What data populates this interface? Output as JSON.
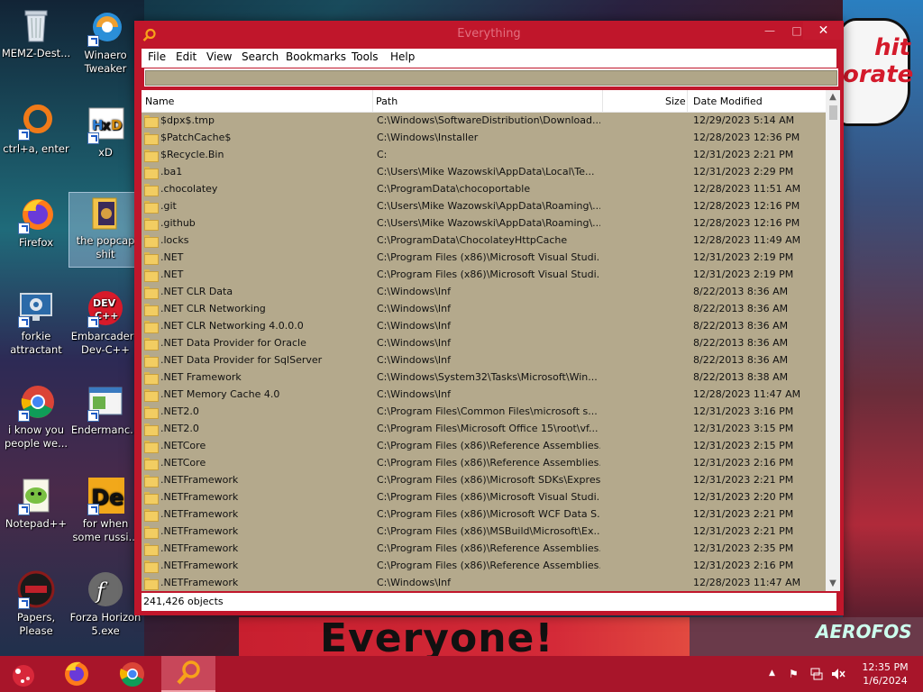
{
  "wallpaper": {
    "bubble_text": "hit\norate",
    "banner_text": "Everyone!",
    "corner_text": "AEROFOS"
  },
  "desktop_icons": [
    {
      "label": "MEMZ-Dest...",
      "icon": "recycle-bin-icon"
    },
    {
      "label": "Winaero Tweaker",
      "icon": "winaero-icon"
    },
    {
      "label": "ctrl+a, enter",
      "icon": "ring-icon"
    },
    {
      "label": "xD",
      "icon": "hxd-icon"
    },
    {
      "label": "Firefox",
      "icon": "firefox-icon"
    },
    {
      "label": "the popcap shit",
      "icon": "folder-icon"
    },
    {
      "label": "forkie attractant",
      "icon": "monitor-gear-icon"
    },
    {
      "label": "Embarcadero Dev-C++",
      "icon": "devcpp-icon"
    },
    {
      "label": "i know you people we...",
      "icon": "chrome-icon"
    },
    {
      "label": "Endermanc...",
      "icon": "window-icon"
    },
    {
      "label": "Notepad++",
      "icon": "notepadpp-icon"
    },
    {
      "label": "for when some russi...",
      "icon": "de-icon"
    },
    {
      "label": "Papers, Please",
      "icon": "papers-please-icon"
    },
    {
      "label": "Forza Horizon 5.exe",
      "icon": "flash-icon"
    }
  ],
  "window": {
    "title": "Everything",
    "menu": [
      "File",
      "Edit",
      "View",
      "Search",
      "Bookmarks",
      "Tools",
      "Help"
    ],
    "search": {
      "value": ""
    },
    "columns": {
      "name": "Name",
      "path": "Path",
      "size": "Size",
      "date": "Date Modified"
    },
    "rows": [
      {
        "name": "$dpx$.tmp",
        "path": "C:\\Windows\\SoftwareDistribution\\Download...",
        "date": "12/29/2023 5:14 AM"
      },
      {
        "name": "$PatchCache$",
        "path": "C:\\Windows\\Installer",
        "date": "12/28/2023 12:36 PM"
      },
      {
        "name": "$Recycle.Bin",
        "path": "C:",
        "date": "12/31/2023 2:21 PM"
      },
      {
        "name": ".ba1",
        "path": "C:\\Users\\Mike Wazowski\\AppData\\Local\\Te...",
        "date": "12/31/2023 2:29 PM"
      },
      {
        "name": ".chocolatey",
        "path": "C:\\ProgramData\\chocoportable",
        "date": "12/28/2023 11:51 AM"
      },
      {
        "name": ".git",
        "path": "C:\\Users\\Mike Wazowski\\AppData\\Roaming\\...",
        "date": "12/28/2023 12:16 PM"
      },
      {
        "name": ".github",
        "path": "C:\\Users\\Mike Wazowski\\AppData\\Roaming\\...",
        "date": "12/28/2023 12:16 PM"
      },
      {
        "name": ".locks",
        "path": "C:\\ProgramData\\ChocolateyHttpCache",
        "date": "12/28/2023 11:49 AM"
      },
      {
        "name": ".NET",
        "path": "C:\\Program Files (x86)\\Microsoft Visual Studi...",
        "date": "12/31/2023 2:19 PM"
      },
      {
        "name": ".NET",
        "path": "C:\\Program Files (x86)\\Microsoft Visual Studi...",
        "date": "12/31/2023 2:19 PM"
      },
      {
        "name": ".NET CLR Data",
        "path": "C:\\Windows\\Inf",
        "date": "8/22/2013 8:36 AM"
      },
      {
        "name": ".NET CLR Networking",
        "path": "C:\\Windows\\Inf",
        "date": "8/22/2013 8:36 AM"
      },
      {
        "name": ".NET CLR Networking 4.0.0.0",
        "path": "C:\\Windows\\Inf",
        "date": "8/22/2013 8:36 AM"
      },
      {
        "name": ".NET Data Provider for Oracle",
        "path": "C:\\Windows\\Inf",
        "date": "8/22/2013 8:36 AM"
      },
      {
        "name": ".NET Data Provider for SqlServer",
        "path": "C:\\Windows\\Inf",
        "date": "8/22/2013 8:36 AM"
      },
      {
        "name": ".NET Framework",
        "path": "C:\\Windows\\System32\\Tasks\\Microsoft\\Win...",
        "date": "8/22/2013 8:38 AM"
      },
      {
        "name": ".NET Memory Cache 4.0",
        "path": "C:\\Windows\\Inf",
        "date": "12/28/2023 11:47 AM"
      },
      {
        "name": ".NET2.0",
        "path": "C:\\Program Files\\Common Files\\microsoft s...",
        "date": "12/31/2023 3:16 PM"
      },
      {
        "name": ".NET2.0",
        "path": "C:\\Program Files\\Microsoft Office 15\\root\\vf...",
        "date": "12/31/2023 3:15 PM"
      },
      {
        "name": ".NETCore",
        "path": "C:\\Program Files (x86)\\Reference Assemblies...",
        "date": "12/31/2023 2:15 PM"
      },
      {
        "name": ".NETCore",
        "path": "C:\\Program Files (x86)\\Reference Assemblies...",
        "date": "12/31/2023 2:16 PM"
      },
      {
        "name": ".NETFramework",
        "path": "C:\\Program Files (x86)\\Microsoft SDKs\\Expres...",
        "date": "12/31/2023 2:21 PM"
      },
      {
        "name": ".NETFramework",
        "path": "C:\\Program Files (x86)\\Microsoft Visual Studi...",
        "date": "12/31/2023 2:20 PM"
      },
      {
        "name": ".NETFramework",
        "path": "C:\\Program Files (x86)\\Microsoft WCF Data S...",
        "date": "12/31/2023 2:21 PM"
      },
      {
        "name": ".NETFramework",
        "path": "C:\\Program Files (x86)\\MSBuild\\Microsoft\\Ex...",
        "date": "12/31/2023 2:21 PM"
      },
      {
        "name": ".NETFramework",
        "path": "C:\\Program Files (x86)\\Reference Assemblies...",
        "date": "12/31/2023 2:35 PM"
      },
      {
        "name": ".NETFramework",
        "path": "C:\\Program Files (x86)\\Reference Assemblies...",
        "date": "12/31/2023 2:16 PM"
      },
      {
        "name": ".NETFramework",
        "path": "C:\\Windows\\Inf",
        "date": "12/28/2023 11:47 AM"
      }
    ],
    "status": "241,426 objects"
  },
  "taskbar": {
    "apps": [
      "start-button",
      "firefox-icon",
      "chrome-icon",
      "everything-icon"
    ],
    "active_app": "everything-icon",
    "time": "12:35 PM",
    "date": "1/6/2024"
  },
  "colors": {
    "window_frame": "#c0162b",
    "list_background": "#b4a98c",
    "taskbar": "#a8152a"
  }
}
